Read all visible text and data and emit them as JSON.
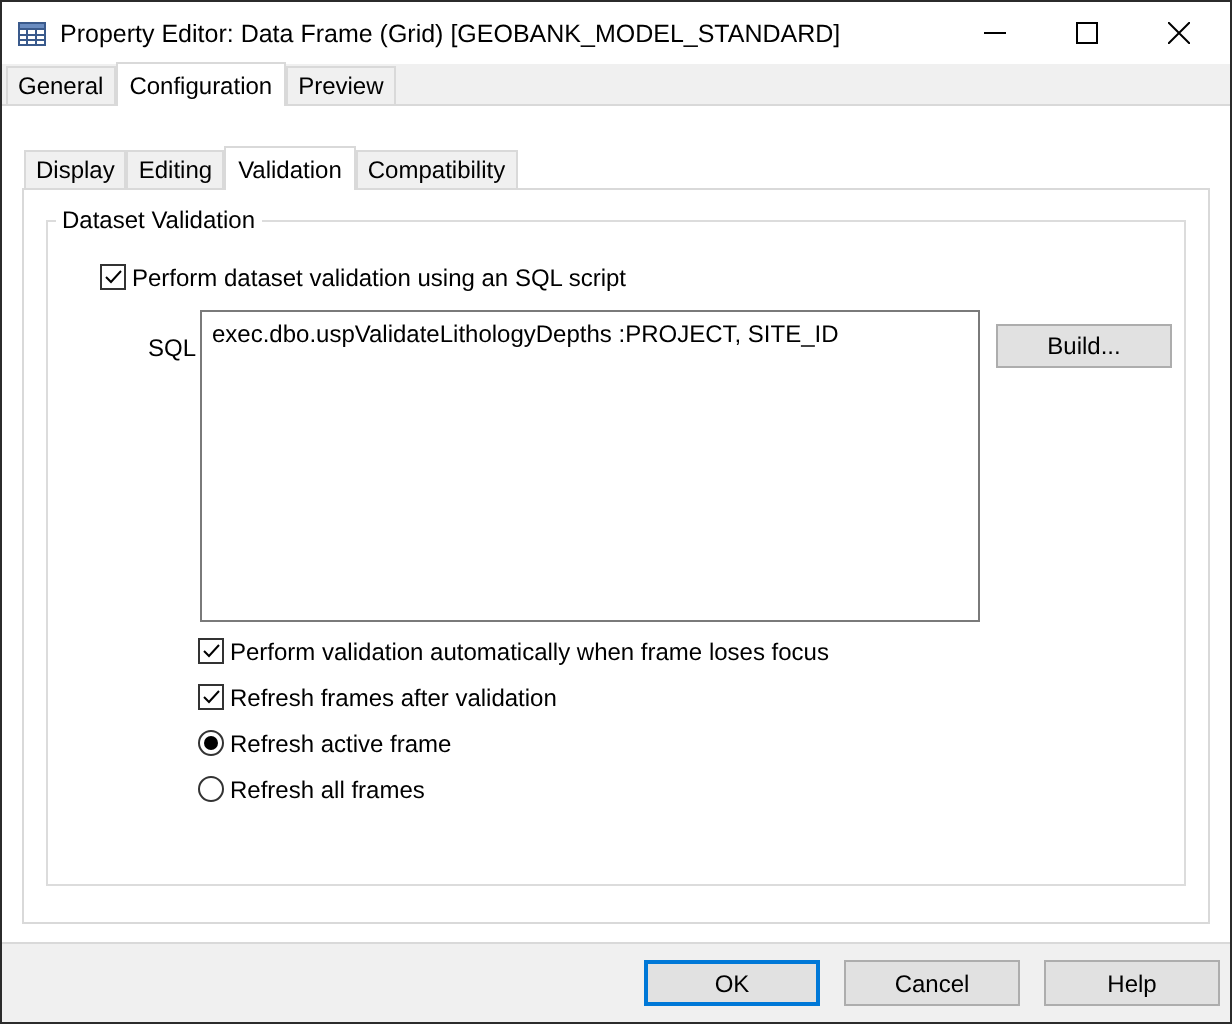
{
  "window": {
    "title": "Property Editor: Data Frame (Grid) [GEOBANK_MODEL_STANDARD]"
  },
  "tabs": [
    {
      "label": "General",
      "selected": false
    },
    {
      "label": "Configuration",
      "selected": true
    },
    {
      "label": "Preview",
      "selected": false
    }
  ],
  "subtabs": [
    {
      "label": "Display",
      "selected": false
    },
    {
      "label": "Editing",
      "selected": false
    },
    {
      "label": "Validation",
      "selected": true
    },
    {
      "label": "Compatibility",
      "selected": false
    }
  ],
  "group": {
    "title": "Dataset Validation",
    "enable": {
      "label": "Perform dataset validation using an SQL script",
      "checked": true
    },
    "sql": {
      "label": "SQL",
      "value": "exec.dbo.uspValidateLithologyDepths :PROJECT, SITE_ID",
      "button": "Build..."
    },
    "options": [
      {
        "kind": "checkbox",
        "label": "Perform validation automatically when frame loses focus",
        "checked": true
      },
      {
        "kind": "checkbox",
        "label": "Refresh frames after validation",
        "checked": true
      },
      {
        "kind": "radio",
        "label": "Refresh active frame",
        "selected": true
      },
      {
        "kind": "radio",
        "label": "Refresh all frames",
        "selected": false
      }
    ]
  },
  "buttons": [
    {
      "label": "OK",
      "default": true
    },
    {
      "label": "Cancel",
      "default": false
    },
    {
      "label": "Help",
      "default": false
    }
  ]
}
